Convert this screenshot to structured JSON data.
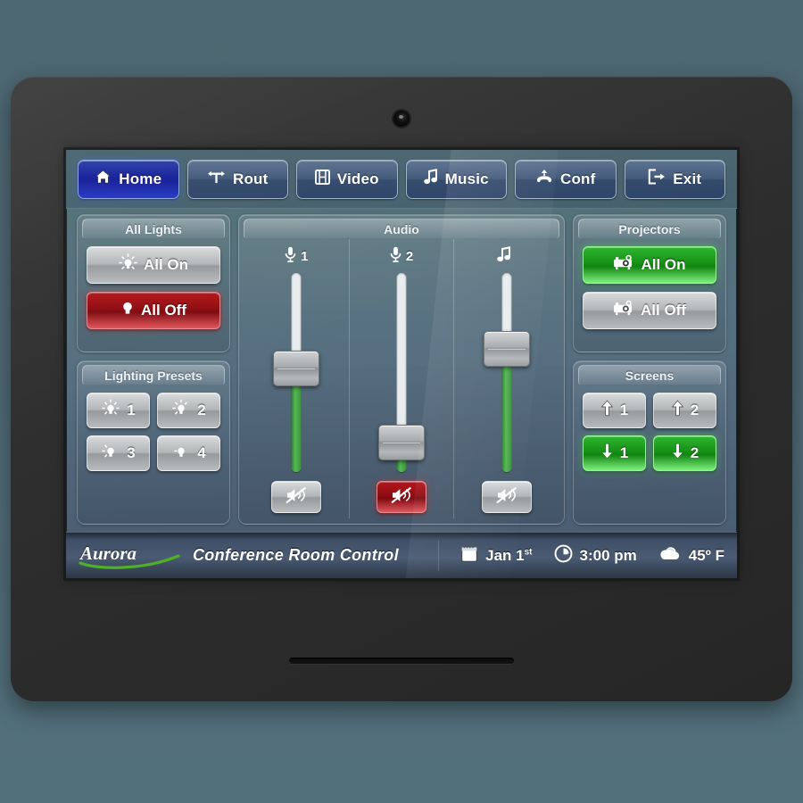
{
  "device": {
    "camera_icon": "camera-lens",
    "speaker_icon": "speaker-grille"
  },
  "nav": {
    "items": [
      {
        "label": "Home",
        "icon": "home-icon",
        "state": "active"
      },
      {
        "label": "Rout",
        "icon": "routing-icon",
        "state": "inactive"
      },
      {
        "label": "Video",
        "icon": "film-icon",
        "state": "inactive"
      },
      {
        "label": "Music",
        "icon": "music-note-icon",
        "state": "inactive"
      },
      {
        "label": "Conf",
        "icon": "phone-conf-icon",
        "state": "inactive"
      },
      {
        "label": "Exit",
        "icon": "exit-icon",
        "state": "inactive"
      }
    ]
  },
  "all_lights": {
    "title": "All Lights",
    "all_on": {
      "label": "All On",
      "icon": "bulb-on-icon",
      "state": "off"
    },
    "all_off": {
      "label": "All Off",
      "icon": "bulb-off-icon",
      "state": "active"
    }
  },
  "lighting_presets": {
    "title": "Lighting Presets",
    "items": [
      {
        "label": "1",
        "icon": "bulb-preset-1-icon",
        "state": "off"
      },
      {
        "label": "2",
        "icon": "bulb-preset-2-icon",
        "state": "off"
      },
      {
        "label": "3",
        "icon": "bulb-preset-3-icon",
        "state": "off"
      },
      {
        "label": "4",
        "icon": "bulb-preset-4-icon",
        "state": "off"
      }
    ]
  },
  "audio": {
    "title": "Audio",
    "channels": [
      {
        "label": "1",
        "icon": "microphone-icon",
        "level": 52,
        "muted": false,
        "mute_icon": "mute-icon"
      },
      {
        "label": "2",
        "icon": "microphone-icon",
        "level": 15,
        "muted": true,
        "mute_icon": "mute-icon"
      },
      {
        "label": "",
        "icon": "music-note-icon",
        "level": 62,
        "muted": false,
        "mute_icon": "mute-icon"
      }
    ]
  },
  "projectors": {
    "title": "Projectors",
    "all_on": {
      "label": "All On",
      "icon": "projector-icon",
      "state": "active"
    },
    "all_off": {
      "label": "All Off",
      "icon": "projector-icon",
      "state": "off"
    }
  },
  "screens": {
    "title": "Screens",
    "items": [
      {
        "label": "1",
        "icon": "arrow-up-icon",
        "state": "off"
      },
      {
        "label": "2",
        "icon": "arrow-up-icon",
        "state": "off"
      },
      {
        "label": "1",
        "icon": "arrow-down-icon",
        "state": "active"
      },
      {
        "label": "2",
        "icon": "arrow-down-icon",
        "state": "active"
      }
    ]
  },
  "status_bar": {
    "brand": "Aurora",
    "title": "Conference Room Control",
    "date": {
      "icon": "calendar-icon",
      "value": "Jan 1",
      "suffix": "st"
    },
    "time": {
      "icon": "clock-icon",
      "value": "3:00 pm"
    },
    "weather": {
      "icon": "cloud-icon",
      "value": "45º F"
    }
  },
  "colors": {
    "accent_blue": "#1720a0",
    "active_green": "#1e9e1e",
    "active_red": "#9e1015",
    "screen_bg": "#53707c"
  }
}
